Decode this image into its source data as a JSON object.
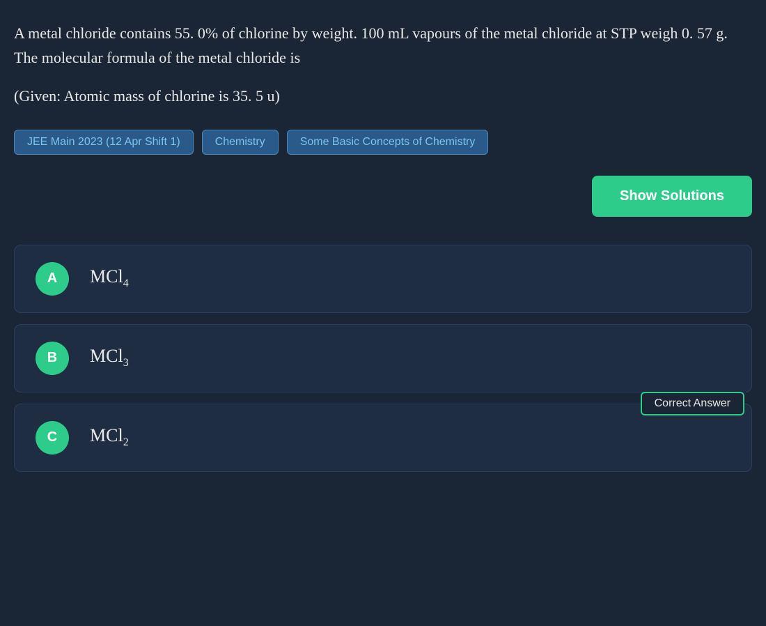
{
  "question": {
    "main_text": "A metal chloride contains 55. 0% of chlorine by weight. 100 mL vapours of the metal chloride at STP weigh 0. 57 g. The molecular formula of the metal chloride is",
    "given_text": "(Given: Atomic mass of chlorine is 35. 5 u)"
  },
  "tags": {
    "exam": "JEE Main 2023 (12 Apr Shift 1)",
    "subject": "Chemistry",
    "chapter": "Some Basic Concepts of Chemistry"
  },
  "buttons": {
    "show_solutions": "Show Solutions"
  },
  "options": [
    {
      "label": "A",
      "formula_base": "MCl",
      "subscript": "4"
    },
    {
      "label": "B",
      "formula_base": "MCl",
      "subscript": "3"
    },
    {
      "label": "C",
      "formula_base": "MCl",
      "subscript": "2",
      "correct": true
    }
  ],
  "correct_answer_badge": "Correct Answer"
}
